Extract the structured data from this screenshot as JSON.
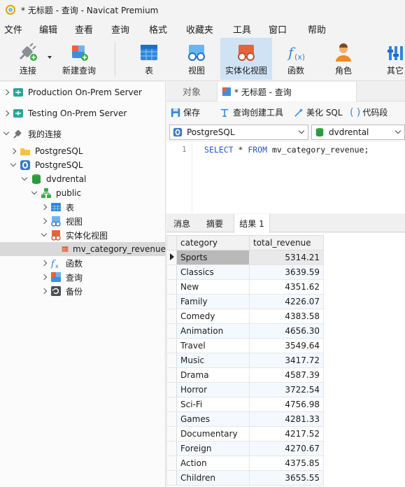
{
  "window": {
    "title": "* 无标题 - 查询 - Navicat Premium"
  },
  "menu": [
    "文件",
    "编辑",
    "查看",
    "查询",
    "格式",
    "收藏夹",
    "工具",
    "窗口",
    "帮助"
  ],
  "toolbar": {
    "connect": "连接",
    "new_query": "新建查询",
    "table": "表",
    "view": "视图",
    "mat_view": "实体化视图",
    "function": "函数",
    "role": "角色",
    "other": "其它"
  },
  "sidebar": {
    "servers": [
      "Production On-Prem Server",
      "Testing On-Prem Server"
    ],
    "my_connections": "我的连接",
    "conn1": "PostgreSQL",
    "conn2": "PostgreSQL",
    "database": "dvdrental",
    "schema": "public",
    "tables": "表",
    "views": "视图",
    "mat_views": "实体化视图",
    "selected_item": "mv_category_revenue",
    "functions": "函数",
    "queries": "查询",
    "backups": "备份"
  },
  "tabs": {
    "objects": "对象",
    "query_tab": "* 无标题 - 查询"
  },
  "query_toolbar": {
    "save": "保存",
    "builder": "查询创建工具",
    "beautify": "美化 SQL",
    "snippet": "代码段"
  },
  "connection": {
    "server": "PostgreSQL",
    "database": "dvdrental"
  },
  "editor": {
    "line_number": "1",
    "kw_select": "SELECT",
    "star": " * ",
    "kw_from": "FROM",
    "rest": " mv_category_revenue;"
  },
  "result_tabs": {
    "messages": "消息",
    "summary": "摘要",
    "result": "结果 1"
  },
  "result": {
    "columns": [
      "category",
      "total_revenue"
    ],
    "rows": [
      [
        "Sports",
        "5314.21"
      ],
      [
        "Classics",
        "3639.59"
      ],
      [
        "New",
        "4351.62"
      ],
      [
        "Family",
        "4226.07"
      ],
      [
        "Comedy",
        "4383.58"
      ],
      [
        "Animation",
        "4656.30"
      ],
      [
        "Travel",
        "3549.64"
      ],
      [
        "Music",
        "3417.72"
      ],
      [
        "Drama",
        "4587.39"
      ],
      [
        "Horror",
        "3722.54"
      ],
      [
        "Sci-Fi",
        "4756.98"
      ],
      [
        "Games",
        "4281.33"
      ],
      [
        "Documentary",
        "4217.52"
      ],
      [
        "Foreign",
        "4270.67"
      ],
      [
        "Action",
        "4375.85"
      ],
      [
        "Children",
        "3655.55"
      ]
    ]
  }
}
